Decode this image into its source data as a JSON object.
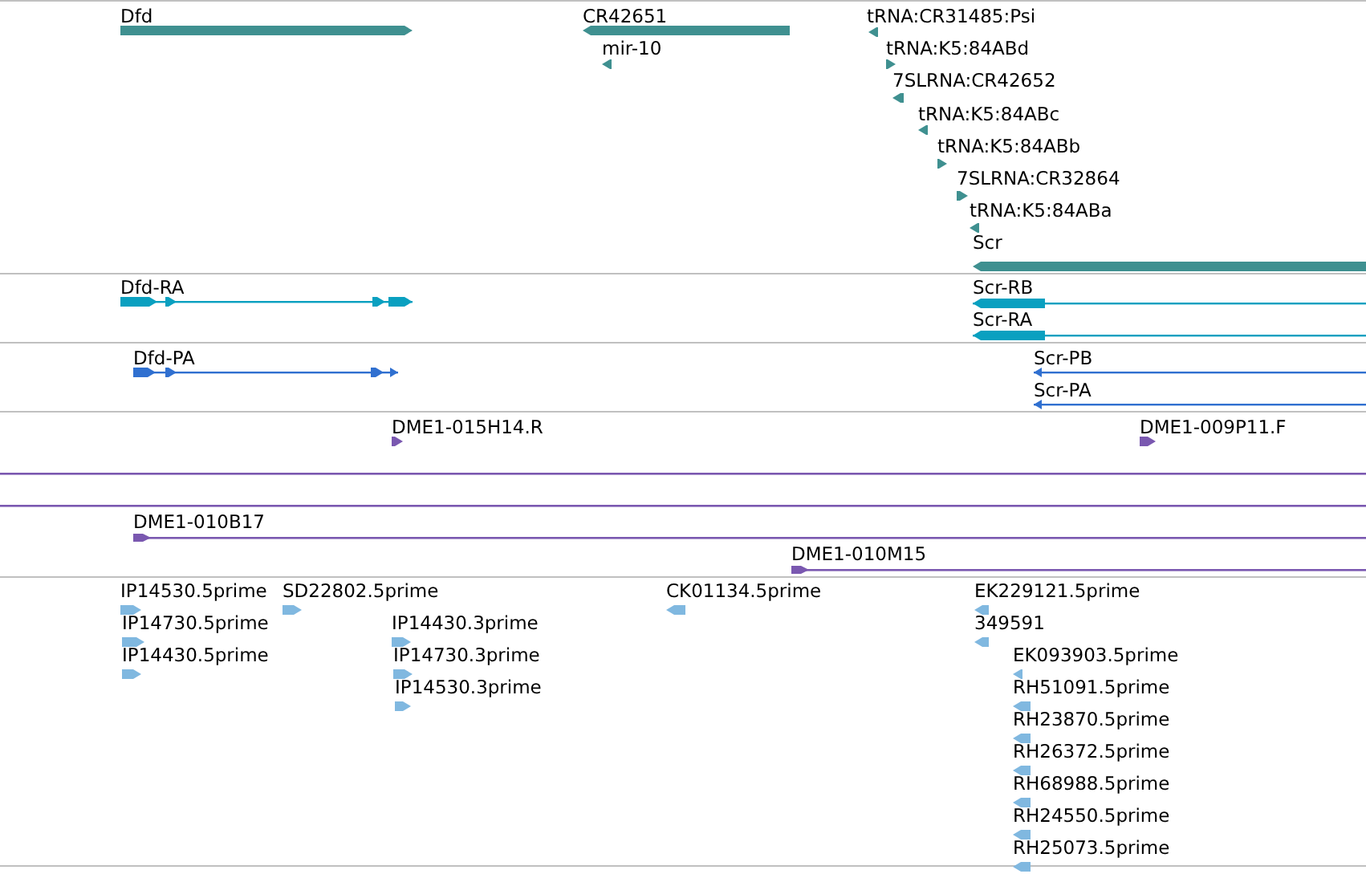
{
  "tracks": [
    {
      "color": "#3f9090",
      "features": [
        {
          "label": "Dfd",
          "kind": "bar",
          "reverse": false
        },
        {
          "label": "CR42651",
          "kind": "bar",
          "reverse": true
        },
        {
          "label": "mir-10",
          "kind": "point",
          "reverse": true
        },
        {
          "label": "tRNA:CR31485:Psi",
          "kind": "point",
          "reverse": true
        },
        {
          "label": "tRNA:K5:84ABd",
          "kind": "point",
          "reverse": false
        },
        {
          "label": "7SLRNA:CR42652",
          "kind": "point",
          "reverse": true
        },
        {
          "label": "tRNA:K5:84ABc",
          "kind": "point",
          "reverse": true
        },
        {
          "label": "tRNA:K5:84ABb",
          "kind": "point",
          "reverse": false
        },
        {
          "label": "7SLRNA:CR32864",
          "kind": "point",
          "reverse": false
        },
        {
          "label": "tRNA:K5:84ABa",
          "kind": "point",
          "reverse": true
        },
        {
          "label": "Scr",
          "kind": "bar",
          "reverse": true
        }
      ]
    },
    {
      "color": "#0aa0c0",
      "features": [
        {
          "label": "Dfd-RA",
          "kind": "spliced",
          "reverse": false
        },
        {
          "label": "Scr-RB",
          "kind": "spliced",
          "reverse": true
        },
        {
          "label": "Scr-RA",
          "kind": "spliced",
          "reverse": true
        }
      ]
    },
    {
      "color": "#3070d0",
      "features": [
        {
          "label": "Dfd-PA",
          "kind": "spliced",
          "reverse": false
        },
        {
          "label": "Scr-PB",
          "kind": "spliced",
          "reverse": true
        },
        {
          "label": "Scr-PA",
          "kind": "spliced",
          "reverse": true
        }
      ]
    },
    {
      "color": "#7a58b0",
      "features": [
        {
          "label": "DME1-015H14.R",
          "kind": "point",
          "reverse": false
        },
        {
          "label": "DME1-009P11.F",
          "kind": "point",
          "reverse": false
        },
        {
          "kind": "line"
        },
        {
          "kind": "line"
        },
        {
          "label": "DME1-010B17",
          "kind": "line",
          "reverse": false
        },
        {
          "label": "DME1-010M15",
          "kind": "line",
          "reverse": false
        }
      ]
    },
    {
      "color": "#80b8e0",
      "features": [
        {
          "label": "IP14530.5prime",
          "kind": "point",
          "reverse": false
        },
        {
          "label": "SD22802.5prime",
          "kind": "point",
          "reverse": false
        },
        {
          "label": "CK01134.5prime",
          "kind": "point",
          "reverse": true
        },
        {
          "label": "EK229121.5prime",
          "kind": "point",
          "reverse": true
        },
        {
          "label": "IP14730.5prime",
          "kind": "point",
          "reverse": false
        },
        {
          "label": "IP14430.3prime",
          "kind": "point",
          "reverse": false
        },
        {
          "label": "349591",
          "kind": "point",
          "reverse": true
        },
        {
          "label": "IP14430.5prime",
          "kind": "point",
          "reverse": false
        },
        {
          "label": "IP14730.3prime",
          "kind": "point",
          "reverse": false
        },
        {
          "label": "EK093903.5prime",
          "kind": "point",
          "reverse": true
        },
        {
          "label": "IP14530.3prime",
          "kind": "point",
          "reverse": false
        },
        {
          "label": "RH51091.5prime",
          "kind": "point",
          "reverse": true
        },
        {
          "label": "RH23870.5prime",
          "kind": "point",
          "reverse": true
        },
        {
          "label": "RH26372.5prime",
          "kind": "point",
          "reverse": true
        },
        {
          "label": "RH68988.5prime",
          "kind": "point",
          "reverse": true
        },
        {
          "label": "RH24550.5prime",
          "kind": "point",
          "reverse": true
        },
        {
          "label": "RH25073.5prime",
          "kind": "point",
          "reverse": true
        }
      ]
    }
  ]
}
